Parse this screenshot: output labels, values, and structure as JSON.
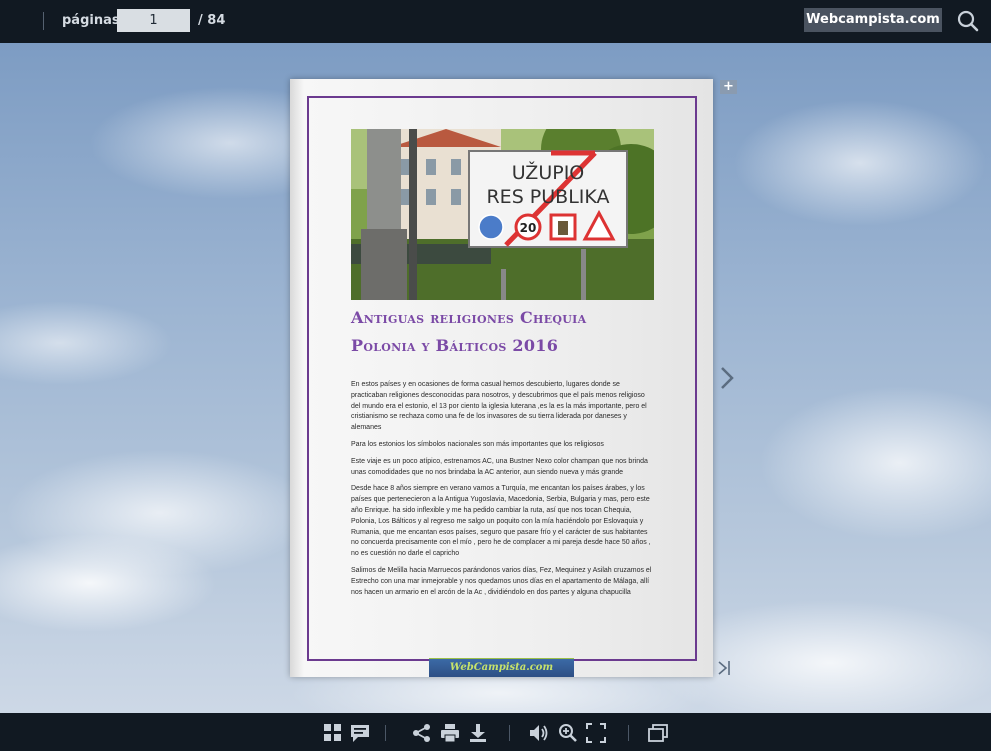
{
  "toolbar": {
    "pages_label": "páginas:",
    "current_page": "1",
    "total_pages": "/ 84",
    "brand": "Webcampista.com",
    "search_icon": "search-icon"
  },
  "page": {
    "sign_line1": "UŽUPIO",
    "sign_line2": "RES PUBLIKA",
    "sign_speed": "20",
    "title_line1": "Antiguas religiones Chequia",
    "title_line2": "Polonia y Bálticos 2016",
    "paragraphs": [
      "En estos países y en ocasiones de forma casual hemos descubierto, lugares donde se practicaban religiones desconocidas para nosotros, y descubrimos que el país menos religioso del mundo era el estonio, el 13 por ciento la iglesia luterana ,es la es la más importante, pero el cristianismo se rechaza como una fe de los invasores de su tierra liderada por daneses y alemanes",
      "Para los estonios los símbolos nacionales son más importantes que los religiosos",
      "Este viaje es un poco atípico, estrenamos AC, una Bustner Nexo color champan que nos brinda unas comodidades que no nos brindaba la AC anterior, aun siendo nueva y más grande",
      "Desde hace 8 años siempre en verano vamos a Turquía, me encantan los países árabes, y los países que pertenecieron a la Antigua Yugoslavia, Macedonia, Serbia, Bulgaria y mas, pero este año Enrique. ha sido inflexible y me ha pedido cambiar la ruta, así que nos tocan Chequia, Polonia, Los Bálticos y al regreso me salgo un poquito con la mía haciéndolo por Eslovaquia y Rumania, que me encantan esos países, seguro que pasare frío y el carácter de sus habitantes no concuerda precisamente con el mío , pero he de complacer a mi pareja desde hace 50 años , no es cuestión no darle el capricho",
      "Salimos de Melilla hacia Marruecos parándonos varios días, Fez, Mequinez y Asilah cruzamos el Estrecho con una mar inmejorable y nos quedamos unos días en el apartamento de Málaga, allí nos hacen un armario en el arcón de la Ac , dividiéndolo en dos partes y alguna chapucilla"
    ],
    "footer_banner": "WebCampista.com"
  },
  "colors": {
    "accent_purple": "#7b4aa6",
    "bar_bg": "#111922",
    "brand_bg": "#4a5360"
  },
  "bottom_icons": [
    "grid-icon",
    "comment-icon",
    "share-icon",
    "print-icon",
    "download-icon",
    "volume-icon",
    "zoom-in-icon",
    "fullscreen-icon",
    "windows-icon"
  ]
}
